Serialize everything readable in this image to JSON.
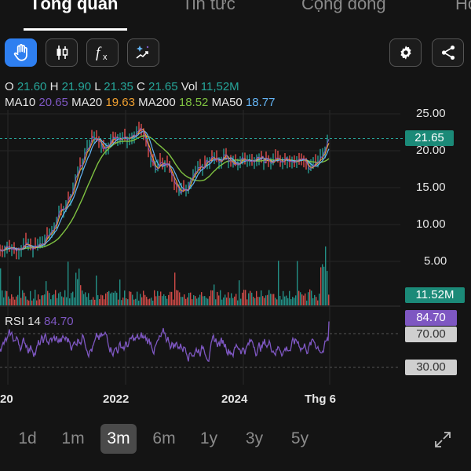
{
  "tabs": [
    {
      "label": "Tổng quan",
      "active": true
    },
    {
      "label": "Tin tức",
      "active": false
    },
    {
      "label": "Cộng đồng",
      "active": false
    },
    {
      "label": "Hồ",
      "active": false
    }
  ],
  "toolbar": {
    "tools": [
      {
        "icon": "hand-icon",
        "active": true
      },
      {
        "icon": "candlestick-icon",
        "active": false
      },
      {
        "icon": "function-icon",
        "active": false
      },
      {
        "icon": "magic-indicator-icon",
        "active": false
      }
    ],
    "settings_icon": "gear-icon",
    "share_icon": "share-icon"
  },
  "ohlc": {
    "o_label": "O",
    "o": "21.60",
    "h_label": "H",
    "h": "21.90",
    "l_label": "L",
    "l": "21.35",
    "c_label": "C",
    "c": "21.65",
    "vol_label": "Vol",
    "vol": "11,52M"
  },
  "ma": {
    "ma10_label": "MA10",
    "ma10": "20.65",
    "ma20_label": "MA20",
    "ma20": "19.63",
    "ma200_label": "MA200",
    "ma200": "18.52",
    "ma50_label": "MA50",
    "ma50": "18.77"
  },
  "colors": {
    "up": "#26a69a",
    "down": "#ef5350",
    "ma10": "#7e57c2",
    "ma20": "#f0a030",
    "ma200": "#7fc241",
    "ma50": "#64b5f6",
    "rsi": "#7e57c2",
    "accent": "#2e7ff0"
  },
  "price_axis": {
    "ticks": [
      "25.00",
      "20.00",
      "15.00",
      "10.00",
      "5.00"
    ]
  },
  "price_tag": "21.65",
  "volume_tag": "11.52M",
  "rsi": {
    "label": "RSI 14",
    "value": "84.70",
    "upper": "70.00",
    "lower": "30.00"
  },
  "x_axis": {
    "labels": [
      "20",
      "2022",
      "2024",
      "Thg 6"
    ]
  },
  "ranges": [
    {
      "label": "1d",
      "active": false
    },
    {
      "label": "1m",
      "active": false
    },
    {
      "label": "3m",
      "active": true
    },
    {
      "label": "6m",
      "active": false
    },
    {
      "label": "1y",
      "active": false
    },
    {
      "label": "3y",
      "active": false
    },
    {
      "label": "5y",
      "active": false
    }
  ],
  "expand_icon": "expand-icon",
  "chart_data": {
    "type": "line",
    "price_series": [
      6.5,
      7,
      6.8,
      6.5,
      7.5,
      6.8,
      7.2,
      8,
      9,
      11,
      12.5,
      14,
      17,
      19,
      21.5,
      22,
      20.5,
      21,
      22,
      21.8,
      21.5,
      22,
      23,
      20,
      17.5,
      18.5,
      18,
      16,
      14.5,
      15,
      17,
      17.5,
      18.5,
      19,
      18.5,
      19.5,
      18,
      18.5,
      19,
      18.5,
      19.5,
      18.5,
      18.5,
      19,
      18.8,
      19,
      18.5,
      19,
      17.5,
      18.5,
      19.5,
      21.65
    ],
    "price_ylim": [
      0,
      25
    ],
    "rsi_ylim": [
      0,
      100
    ],
    "current_price": 21.65,
    "current_rsi": 84.7
  }
}
